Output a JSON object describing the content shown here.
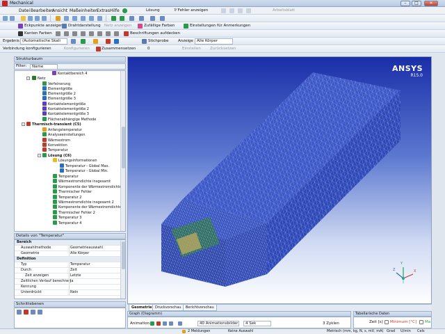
{
  "window": {
    "title": "Mechanical",
    "buttons": [
      "–",
      "□",
      "✕"
    ]
  },
  "menu": [
    "Datei",
    "Bearbeiten",
    "Ansicht",
    "Maßeinheiten",
    "Extras",
    "Hilfe"
  ],
  "toolbar1": {
    "solve_label": "Lösung",
    "show_errors_label": "?⁄ Fehler anzeigen",
    "worksheet_label": "Arbeitsblatt"
  },
  "toolbar2": {
    "vertices_label": "Eckpunkte anzeigen",
    "wireframe_label": "Drahtdarstellung",
    "mesh_label": "Netz anzeigen",
    "random_colors_label": "Zufällige Farben",
    "annotation_settings_label": "Einstellungen für Anmerkungen"
  },
  "toolbar3": {
    "edge_colors_label": "Kanten Farben",
    "labels_label": "Beschriftungen aufdecken"
  },
  "toolbar4": {
    "result_label": "Ergebnis",
    "scale_value": "(Automatische Skali",
    "probe_label": "Stichprobe",
    "display_label": "Anzeige",
    "display_value": "Alle Körper"
  },
  "toolbar5": {
    "connections_label": "Verbindung konfigurieren",
    "configure_label": "Konfigurieren",
    "merge_label": "Zusammensetzen",
    "count_value": "0",
    "settings_label": "Einstellen",
    "reset_label": "Zurücksetzen"
  },
  "tree": {
    "header": "Strukturbaum",
    "filter_label": "Filter:",
    "filter_value": "Name",
    "items": [
      {
        "label": "Kontaktbereich 4",
        "color": "#7a3fbf"
      },
      {
        "label": "Netz",
        "color": "#2a7a2a"
      },
      {
        "label": "Verfeinerung",
        "color": "#2a9a4a"
      },
      {
        "label": "Elementgröße",
        "color": "#2a6fbf"
      },
      {
        "label": "Elementgröße 2",
        "color": "#2a6fbf"
      },
      {
        "label": "Elementgröße 3",
        "color": "#2a6fbf"
      },
      {
        "label": "Kontaktelementgröße",
        "color": "#5a3fbf"
      },
      {
        "label": "Kontaktelementgröße 2",
        "color": "#5a3fbf"
      },
      {
        "label": "Kontaktelementgröße 3",
        "color": "#5a3fbf"
      },
      {
        "label": "Flächenabhängige Methode",
        "color": "#2a9a4a"
      },
      {
        "label": "Thermisch-transient (C5)",
        "color": "#c0392b"
      },
      {
        "label": "Anfangstemperatur",
        "color": "#e0a020"
      },
      {
        "label": "Analyseeinstellungen",
        "color": "#2a9a4a"
      },
      {
        "label": "Wärmestrom",
        "color": "#c0392b"
      },
      {
        "label": "Konvektion",
        "color": "#c0392b"
      },
      {
        "label": "Temperatur",
        "color": "#c0392b"
      },
      {
        "label": "Lösung (C6)",
        "color": "#2a9a4a"
      },
      {
        "label": "Lösungsinformationen",
        "color": "#e0c020"
      },
      {
        "label": "Temperatur - Global Max.",
        "color": "#2a6fbf"
      },
      {
        "label": "Temperatur - Global Min.",
        "color": "#2a6fbf"
      },
      {
        "label": "Temperatur",
        "color": "#2a9a4a"
      },
      {
        "label": "Wärmestromdichte insgesamt",
        "color": "#2a9a4a"
      },
      {
        "label": "Komponente der Wärmestromdichte",
        "color": "#2a9a4a"
      },
      {
        "label": "Thermischer Fehler",
        "color": "#2a9a4a"
      },
      {
        "label": "Temperatur 2",
        "color": "#2a9a4a"
      },
      {
        "label": "Wärmestromdichte insgesamt 2",
        "color": "#2a9a4a"
      },
      {
        "label": "Komponente der Wärmestromdichte 2",
        "color": "#2a9a4a"
      },
      {
        "label": "Thermischer Fehler 2",
        "color": "#2a9a4a"
      },
      {
        "label": "Temperatur 3",
        "color": "#2a9a4a"
      },
      {
        "label": "Temperatur 4",
        "color": "#2a9a4a"
      }
    ]
  },
  "details": {
    "header": "Details von \"Temperatur\"",
    "rows": [
      {
        "key": "Bereich",
        "value": "",
        "group": true
      },
      {
        "key": "Auswahlmethode",
        "value": "Geometrieauswahl",
        "group": false
      },
      {
        "key": "Geometrie",
        "value": "Alle Körper",
        "group": false
      },
      {
        "key": "Definition",
        "value": "",
        "group": true
      },
      {
        "key": "Typ",
        "value": "Temperatur",
        "group": false
      },
      {
        "key": "Durch",
        "value": "Zeit",
        "group": false
      },
      {
        "key": "Zeit anzeigen",
        "value": "Letzte",
        "group": false
      },
      {
        "key": "Zeitlichen Verlauf berechnen",
        "value": "Ja",
        "group": false
      },
      {
        "key": "Kennung",
        "value": "",
        "group": false
      },
      {
        "key": "Unterdrückt",
        "value": "Nein",
        "group": false
      }
    ]
  },
  "sections": {
    "header": "Schnittebenen"
  },
  "viewport": {
    "brand": "ANSYS",
    "release": "R15.0",
    "axes": {
      "x": "X",
      "y": "Y",
      "z": "Z"
    }
  },
  "view_tabs": [
    "Geometrie",
    "Druckvorschau",
    "Berichtvorschau"
  ],
  "graph": {
    "header": "Graph (Diagramm)",
    "animation_label": "Animation",
    "frames_label": "40 Animationsbilder",
    "duration_label": "4 Sek",
    "cycles_label": "3 Zyklen"
  },
  "tabular": {
    "header": "Tabellarische Daten",
    "col_time": "Zeit [s]",
    "col_min": "Minimum [°C]",
    "col_max": "Ma"
  },
  "status": {
    "messages": "2 Meldungen",
    "selection": "Keine Auswahl",
    "units": "Metrisch (mm, kg, N, s, mV, mA)",
    "angle": "Grad",
    "speed": "U/min",
    "temp": "Cels"
  }
}
